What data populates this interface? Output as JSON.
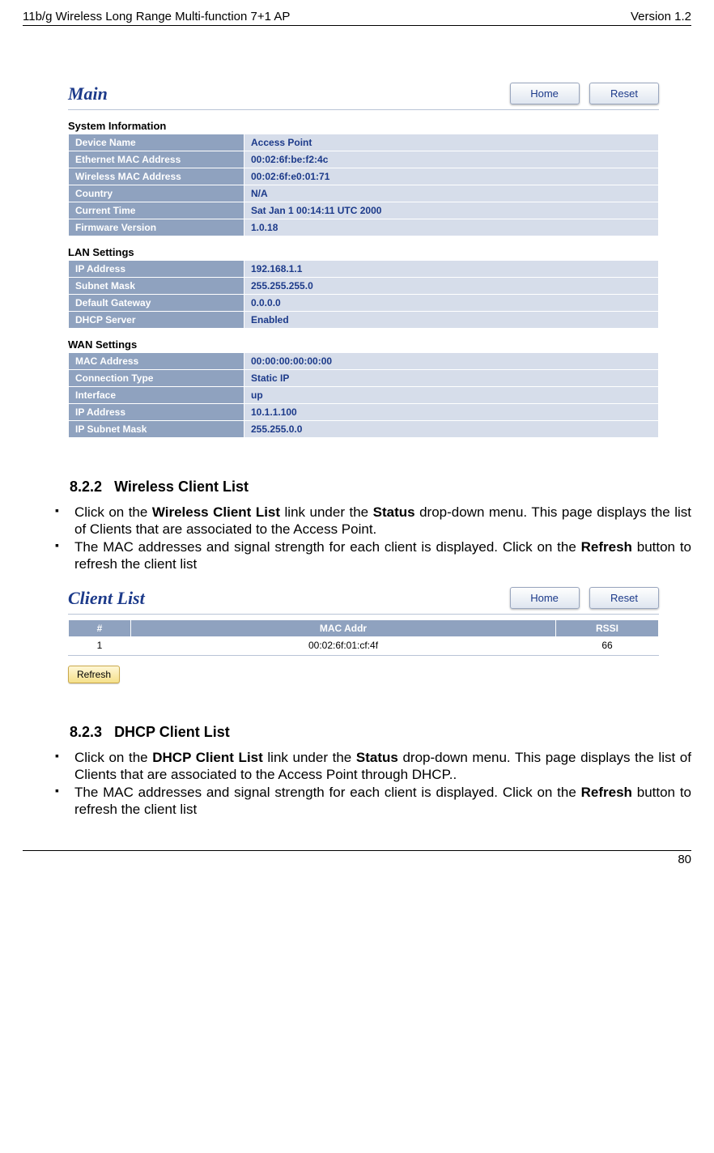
{
  "header": {
    "left": "11b/g Wireless Long Range Multi-function 7+1 AP",
    "right": "Version 1.2"
  },
  "footer": {
    "page": "80"
  },
  "main_shot": {
    "title": "Main",
    "home": "Home",
    "reset": "Reset",
    "sys_label": "System Information",
    "sys": [
      {
        "k": "Device Name",
        "v": "Access Point"
      },
      {
        "k": "Ethernet MAC Address",
        "v": "00:02:6f:be:f2:4c"
      },
      {
        "k": "Wireless MAC Address",
        "v": "00:02:6f:e0:01:71"
      },
      {
        "k": "Country",
        "v": "N/A"
      },
      {
        "k": "Current Time",
        "v": "Sat Jan 1 00:14:11 UTC 2000"
      },
      {
        "k": "Firmware Version",
        "v": "1.0.18"
      }
    ],
    "lan_label": "LAN Settings",
    "lan": [
      {
        "k": "IP Address",
        "v": "192.168.1.1"
      },
      {
        "k": "Subnet Mask",
        "v": "255.255.255.0"
      },
      {
        "k": "Default Gateway",
        "v": "0.0.0.0"
      },
      {
        "k": "DHCP Server",
        "v": "Enabled"
      }
    ],
    "wan_label": "WAN Settings",
    "wan": [
      {
        "k": "MAC Address",
        "v": "00:00:00:00:00:00"
      },
      {
        "k": "Connection Type",
        "v": "Static IP"
      },
      {
        "k": "Interface",
        "v": "up"
      },
      {
        "k": "IP Address",
        "v": "10.1.1.100"
      },
      {
        "k": "IP Subnet Mask",
        "v": "255.255.0.0"
      }
    ]
  },
  "sec822": {
    "num": "8.2.2",
    "title": "Wireless Client List",
    "b1_a": "Click on the ",
    "b1_b": "Wireless Client List",
    "b1_c": " link under the ",
    "b1_d": "Status",
    "b1_e": " drop-down menu. This page displays the list of Clients that are associated to the Access Point.",
    "b2_a": "The MAC addresses and signal strength for each client is displayed. Click on the ",
    "b2_b": "Refresh",
    "b2_c": " button to refresh the client list"
  },
  "client_shot": {
    "title": "Client List",
    "home": "Home",
    "reset": "Reset",
    "cols": {
      "c1": "#",
      "c2": "MAC Addr",
      "c3": "RSSI"
    },
    "row": {
      "c1": "1",
      "c2": "00:02:6f:01:cf:4f",
      "c3": "66"
    },
    "refresh": "Refresh"
  },
  "sec823": {
    "num": "8.2.3",
    "title": "DHCP Client List",
    "b1_a": "Click on the ",
    "b1_b": "DHCP Client List",
    "b1_c": " link under the ",
    "b1_d": "Status",
    "b1_e": " drop-down menu. This page displays the list of Clients that are associated to the Access Point through DHCP..",
    "b2_a": "The MAC addresses and signal strength for each client is displayed. Click on the ",
    "b2_b": "Refresh",
    "b2_c": " button to refresh the client list"
  }
}
